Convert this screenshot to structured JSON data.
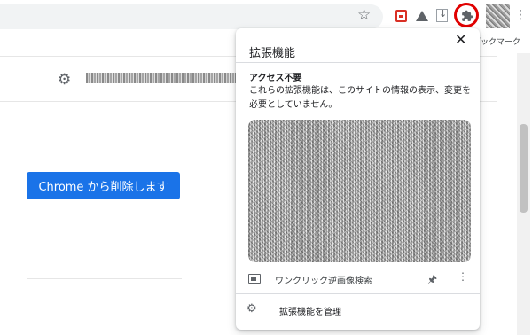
{
  "toolbar": {
    "icons": [
      "star-icon",
      "extension-red-icon",
      "drive-icon",
      "download-icon",
      "puzzle-icon",
      "avatar",
      "menu-dots-icon"
    ],
    "menu_dots": "⋮",
    "bookmarks_partial": "のブックマーク"
  },
  "page": {
    "remove_button": "Chrome から削除します"
  },
  "popup": {
    "title": "拡張機能",
    "close": "✕",
    "access_heading": "アクセス不要",
    "access_description": "これらの拡張機能は、このサイトの情報の表示、変更を必要としていません。",
    "extension_name": "ワンクリック逆画像検索",
    "pin_icon": "🖈",
    "more_icon": "⋮",
    "manage_label": "拡張機能を管理"
  }
}
